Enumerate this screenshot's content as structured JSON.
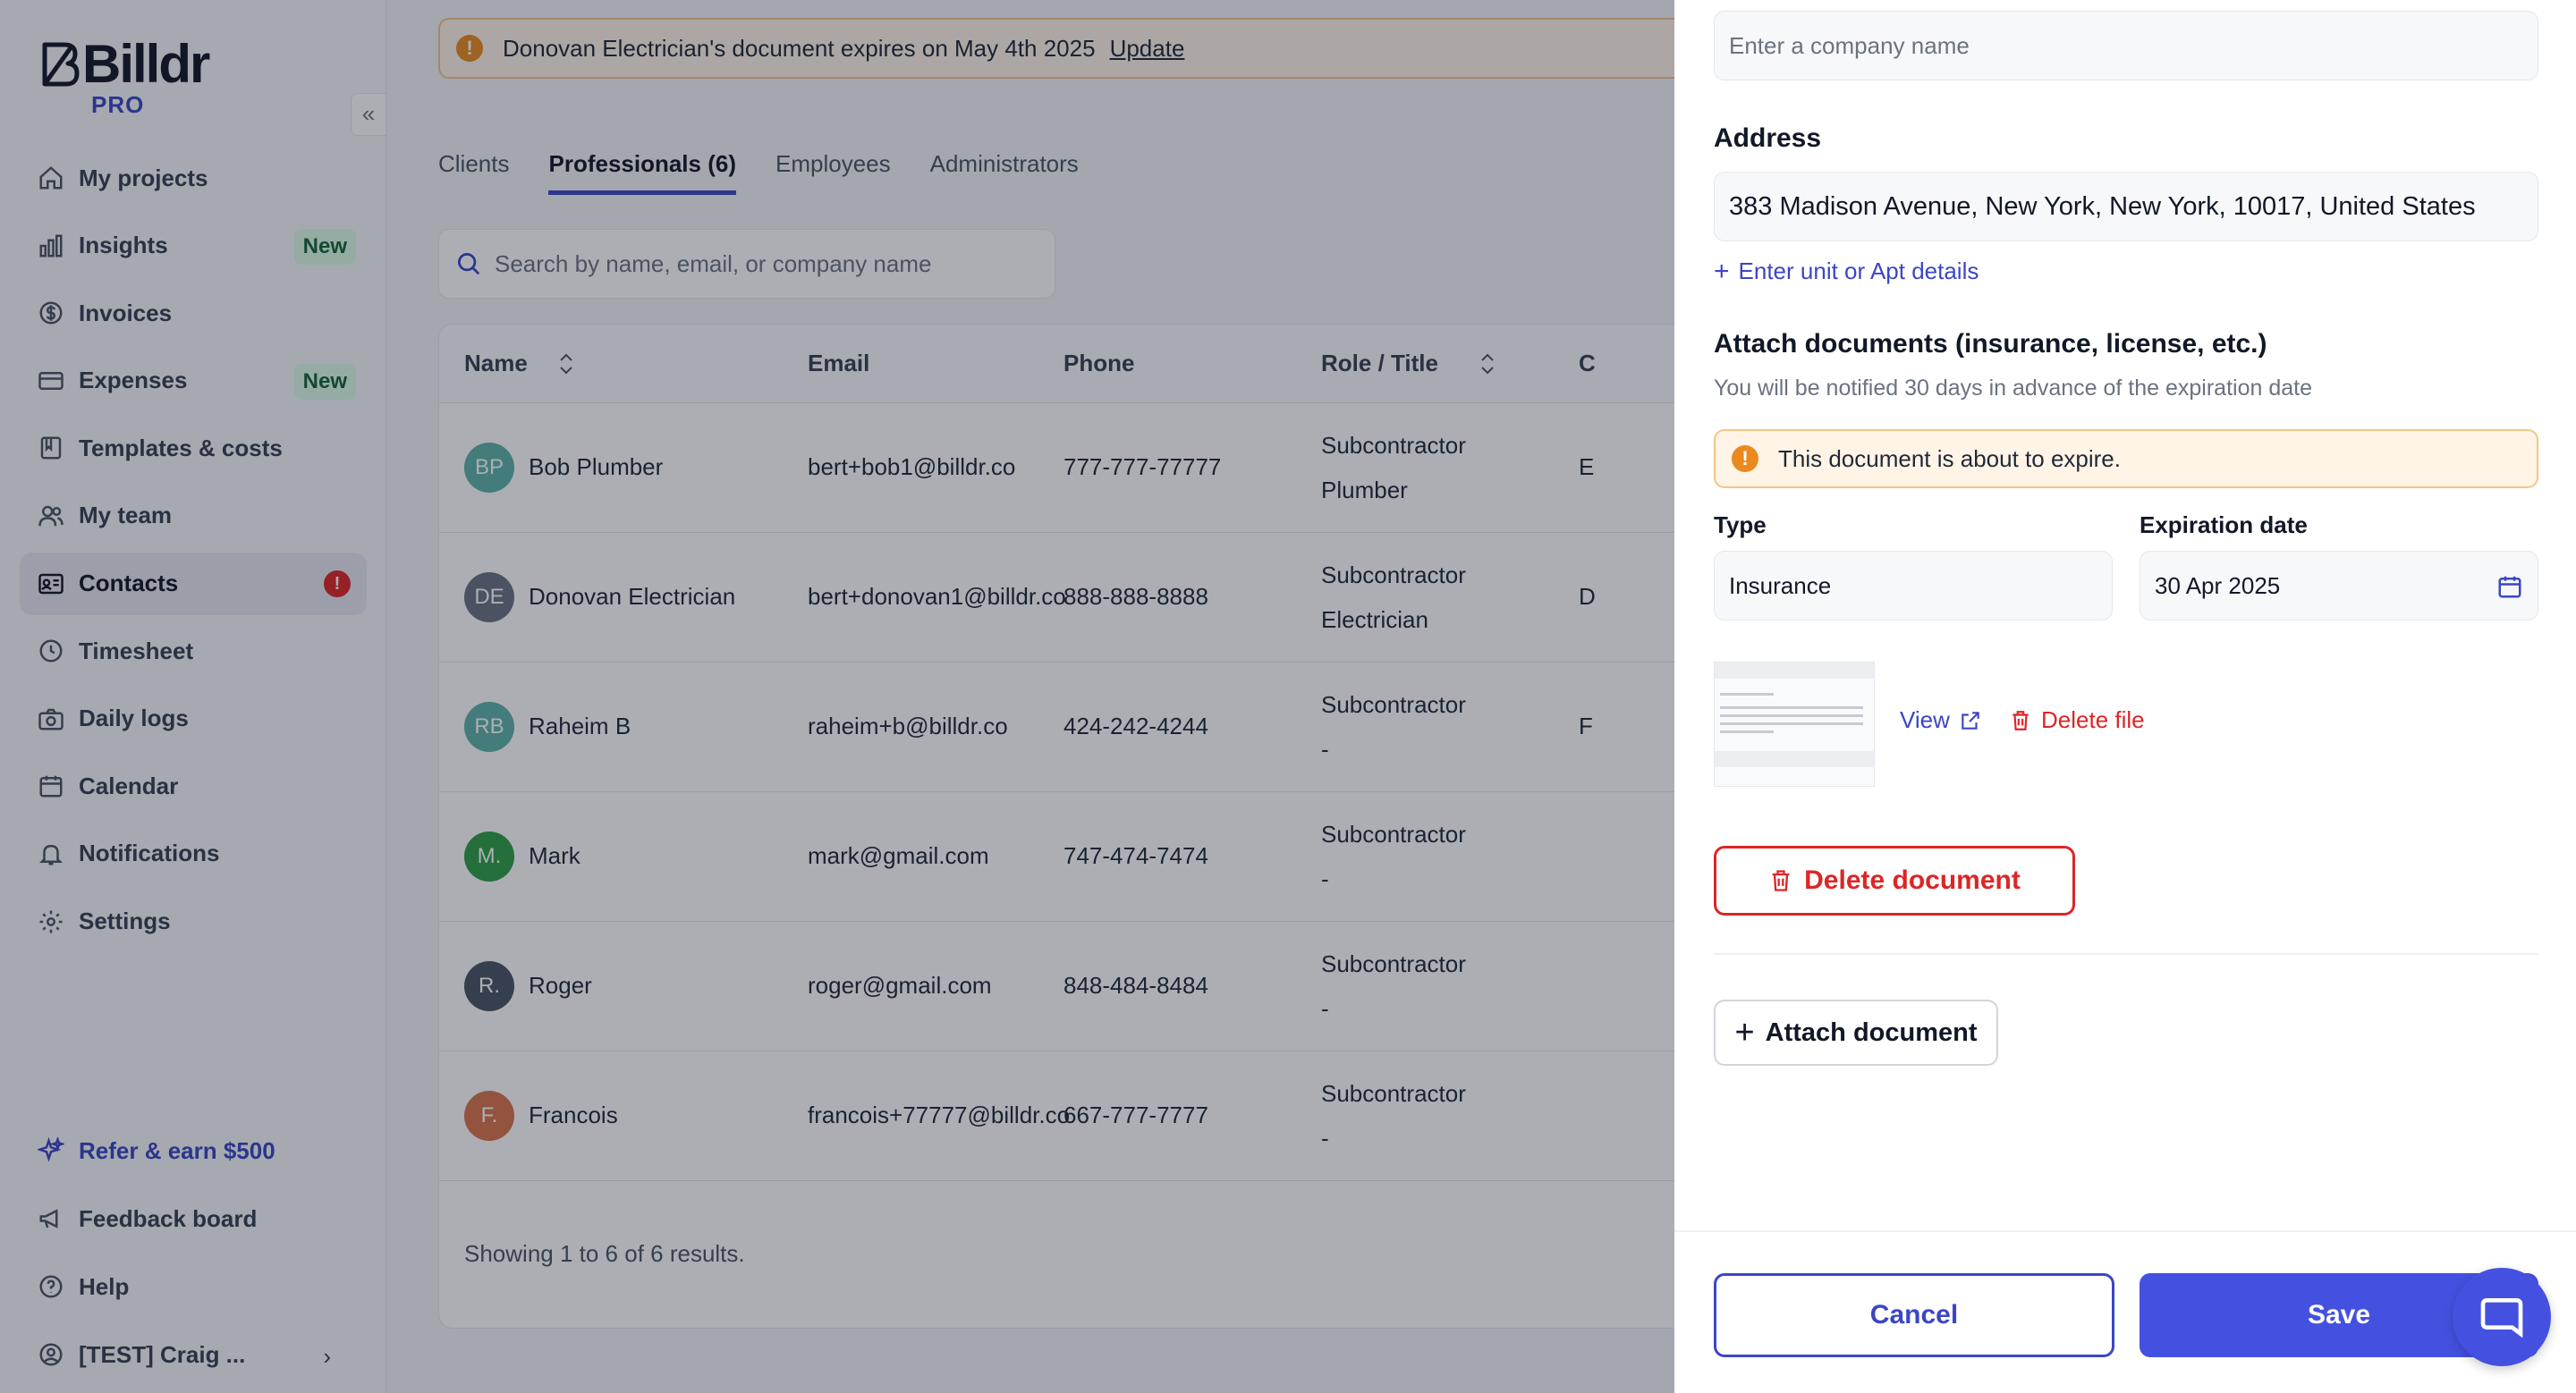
{
  "brand": {
    "name": "Billdr",
    "tier": "PRO"
  },
  "sidebar": {
    "collapse_glyph": "«",
    "items": [
      {
        "label": "My projects",
        "icon": "home-icon"
      },
      {
        "label": "Insights",
        "icon": "bar-chart-icon",
        "badge": "New"
      },
      {
        "label": "Invoices",
        "icon": "dollar-icon"
      },
      {
        "label": "Expenses",
        "icon": "credit-card-icon",
        "badge": "New"
      },
      {
        "label": "Templates & costs",
        "icon": "book-icon"
      },
      {
        "label": "My team",
        "icon": "users-icon"
      },
      {
        "label": "Contacts",
        "icon": "contact-card-icon",
        "alert": "!"
      },
      {
        "label": "Timesheet",
        "icon": "clock-icon"
      },
      {
        "label": "Daily logs",
        "icon": "camera-icon"
      },
      {
        "label": "Calendar",
        "icon": "calendar-icon"
      },
      {
        "label": "Notifications",
        "icon": "bell-icon"
      },
      {
        "label": "Settings",
        "icon": "gear-icon"
      }
    ],
    "bottom": {
      "refer": "Refer & earn $500",
      "feedback": "Feedback board",
      "help": "Help",
      "user": "[TEST] Craig ...",
      "user_chevron": "›"
    }
  },
  "alert": {
    "text": "Donovan Electrician's document expires on May 4th 2025",
    "link": "Update"
  },
  "tabs": [
    "Clients",
    "Professionals (6)",
    "Employees",
    "Administrators"
  ],
  "search": {
    "placeholder": "Search by name, email, or company name"
  },
  "table": {
    "headers": {
      "name": "Name",
      "email": "Email",
      "phone": "Phone",
      "role": "Role / Title"
    },
    "rows": [
      {
        "initials": "BP",
        "name": "Bob Plumber",
        "email": "bert+bob1@billdr.co",
        "phone": "777-777-77777",
        "role": "Subcontractor",
        "title": "Plumber",
        "trunc": "E",
        "color": "#5fb3a6"
      },
      {
        "initials": "DE",
        "name": "Donovan Electrician",
        "email": "bert+donovan1@billdr.co",
        "phone": "888-888-8888",
        "role": "Subcontractor",
        "title": "Electrician",
        "trunc": "D",
        "color": "#6b7280"
      },
      {
        "initials": "RB",
        "name": "Raheim B",
        "email": "raheim+b@billdr.co",
        "phone": "424-242-4244",
        "role": "Subcontractor",
        "title": "-",
        "trunc": "F",
        "color": "#5fb3a6"
      },
      {
        "initials": "M.",
        "name": "Mark",
        "email": "mark@gmail.com",
        "phone": "747-474-7474",
        "role": "Subcontractor",
        "title": "-",
        "trunc": "",
        "color": "#2f9e44"
      },
      {
        "initials": "R.",
        "name": "Roger",
        "email": "roger@gmail.com",
        "phone": "848-484-8484",
        "role": "Subcontractor",
        "title": "-",
        "trunc": "",
        "color": "#4b5563"
      },
      {
        "initials": "F.",
        "name": "Francois",
        "email": "francois+77777@billdr.co",
        "phone": "667-777-7777",
        "role": "Subcontractor",
        "title": "-",
        "trunc": "",
        "color": "#d9734a"
      }
    ],
    "footer": "Showing 1 to 6 of 6 results."
  },
  "drawer": {
    "company": {
      "placeholder": "Enter a company name"
    },
    "address": {
      "label": "Address",
      "value": "383 Madison Avenue, New York, New York, 10017, United States",
      "unit_link": "Enter unit or Apt details"
    },
    "documents": {
      "title": "Attach documents (insurance, license, etc.)",
      "subtitle": "You will be notified 30 days in advance of the expiration date",
      "warning": "This document is about to expire.",
      "type_label": "Type",
      "type_value": "Insurance",
      "expiration_label": "Expiration date",
      "expiration_value": "30 Apr 2025",
      "view": "View",
      "delete_file": "Delete file",
      "delete_document": "Delete document",
      "attach": "Attach document"
    },
    "cancel": "Cancel",
    "save": "Save"
  },
  "colors": {
    "accent": "#4451e0",
    "danger": "#dc2626",
    "warning": "#ea8a1e"
  }
}
